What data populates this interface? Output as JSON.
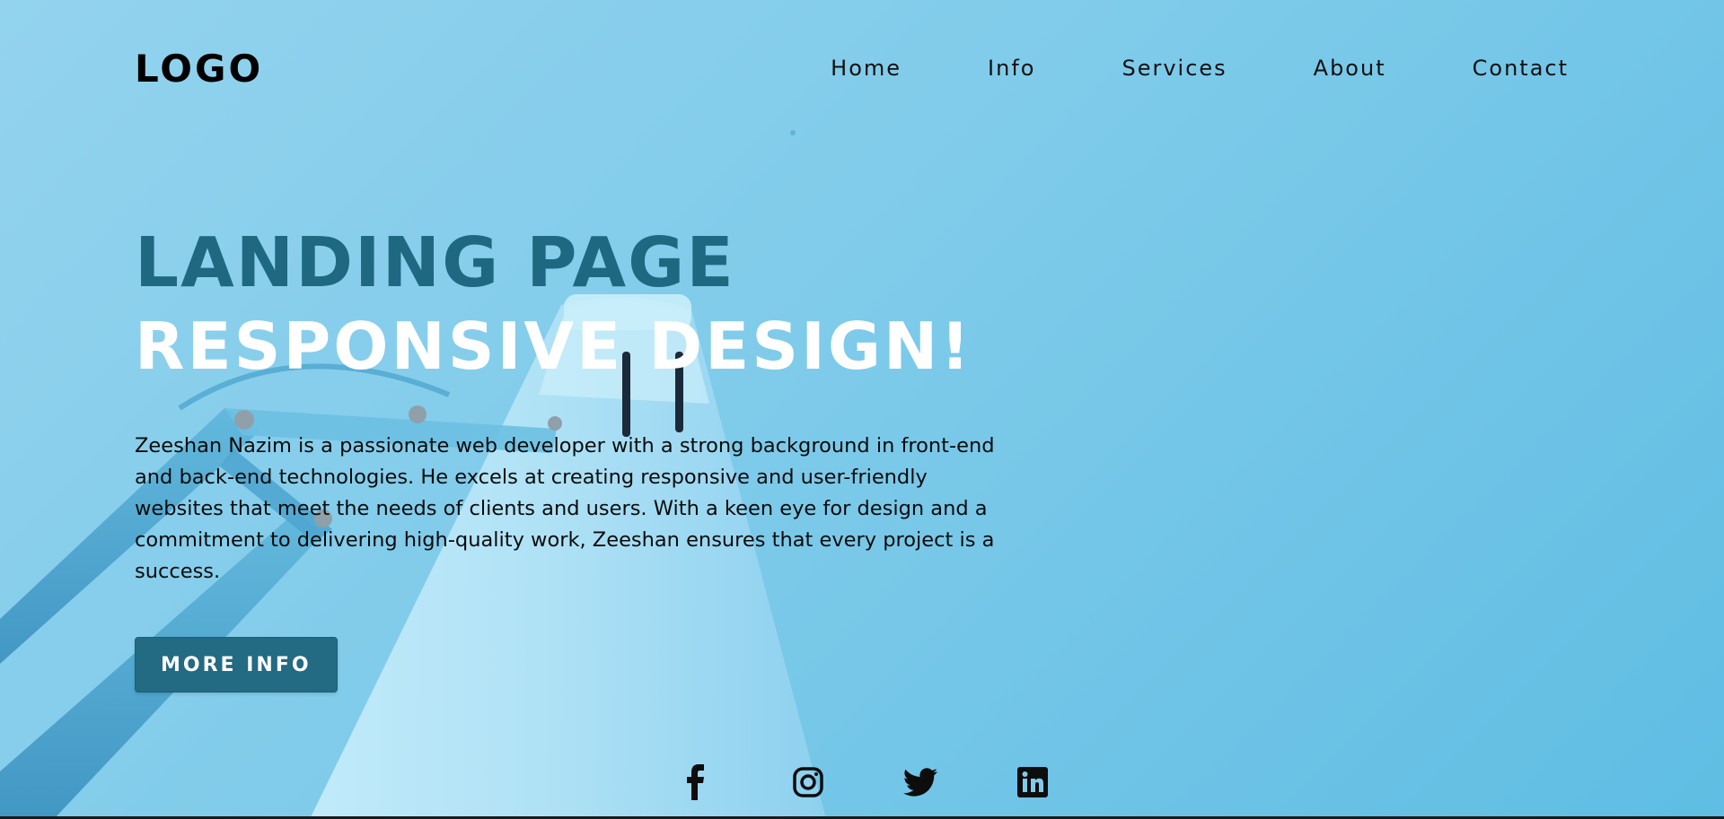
{
  "brand": {
    "logo_text": "LOGO"
  },
  "nav": {
    "items": [
      {
        "label": "Home"
      },
      {
        "label": "Info"
      },
      {
        "label": "Services"
      },
      {
        "label": "About"
      },
      {
        "label": "Contact"
      }
    ]
  },
  "hero": {
    "title_line1": "LANDING PAGE",
    "title_line2": "RESPONSIVE DESIGN!",
    "description": "Zeeshan Nazim is a passionate web developer with a strong background in front-end and back-end technologies. He excels at creating responsive and user-friendly websites that meet the needs of clients and users. With a keen eye for design and a commitment to delivering high-quality work, Zeeshan ensures that every project is a success.",
    "cta_label": "MORE INFO"
  },
  "social": {
    "icons": [
      "facebook-icon",
      "instagram-icon",
      "twitter-icon",
      "linkedin-icon"
    ]
  },
  "colors": {
    "background": "#7fcbea",
    "title_dark": "#1f6882",
    "title_light": "#ffffff",
    "button": "#236a83"
  }
}
